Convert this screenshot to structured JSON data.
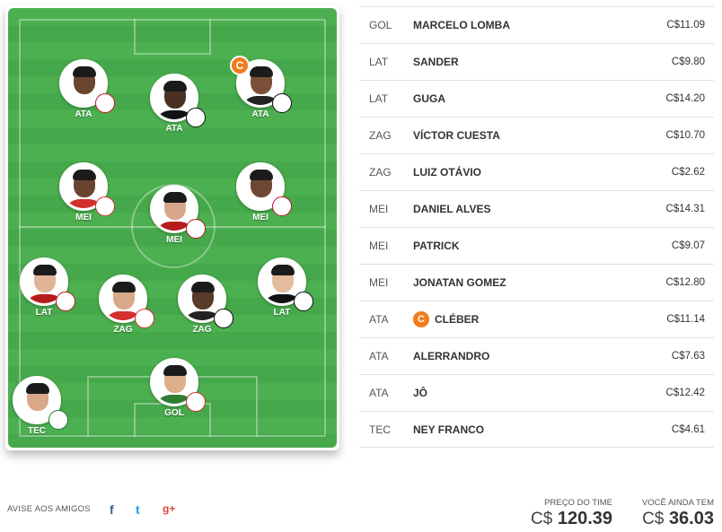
{
  "field": {
    "players": [
      {
        "id": "ata1",
        "pos": "ATA",
        "skin": "#6b4530",
        "shirt": "#ffffff",
        "badge": "RB",
        "badge_color": "#c8102e"
      },
      {
        "id": "ata2",
        "pos": "ATA",
        "skin": "#4a3124",
        "shirt": "#111111",
        "badge": "SC",
        "badge_color": "#111111"
      },
      {
        "id": "ata3",
        "pos": "ATA",
        "skin": "#7a5038",
        "shirt": "#222222",
        "badge": "CE",
        "badge_color": "#111111",
        "captain": "C"
      },
      {
        "id": "mei1",
        "pos": "MEI",
        "skin": "#6a4330",
        "shirt": "#d32f2f",
        "badge": "SCI",
        "badge_color": "#d32f2f"
      },
      {
        "id": "mei2",
        "pos": "MEI",
        "skin": "#d6a78a",
        "shirt": "#b71c1c",
        "badge": "SR",
        "badge_color": "#b71c1c"
      },
      {
        "id": "mei3",
        "pos": "MEI",
        "skin": "#6e4833",
        "shirt": "#ffffff",
        "badge": "SPFC",
        "badge_color": "#c8102e"
      },
      {
        "id": "lat1",
        "pos": "LAT",
        "skin": "#e0b496",
        "shirt": "#b71c1c",
        "badge": "SR",
        "badge_color": "#b71c1c"
      },
      {
        "id": "zag1",
        "pos": "ZAG",
        "skin": "#d9a888",
        "shirt": "#d32f2f",
        "badge": "SCI",
        "badge_color": "#d32f2f"
      },
      {
        "id": "zag2",
        "pos": "ZAG",
        "skin": "#5a3a28",
        "shirt": "#222222",
        "badge": "CE",
        "badge_color": "#111111"
      },
      {
        "id": "lat2",
        "pos": "LAT",
        "skin": "#e4bc9c",
        "shirt": "#111111",
        "badge": "CAM",
        "badge_color": "#111111"
      },
      {
        "id": "tec",
        "pos": "TEC",
        "skin": "#d9a888",
        "shirt": "#ffffff",
        "badge": "G",
        "badge_color": "#1e7a3c"
      },
      {
        "id": "gol",
        "pos": "GOL",
        "skin": "#dcae8c",
        "shirt": "#2e7d32",
        "badge": "SCI",
        "badge_color": "#d32f2f"
      }
    ]
  },
  "roster": [
    {
      "pos": "GOL",
      "name": "MARCELO LOMBA",
      "price": "C$11.09"
    },
    {
      "pos": "LAT",
      "name": "SANDER",
      "price": "C$9.80"
    },
    {
      "pos": "LAT",
      "name": "GUGA",
      "price": "C$14.20"
    },
    {
      "pos": "ZAG",
      "name": "VÍCTOR CUESTA",
      "price": "C$10.70"
    },
    {
      "pos": "ZAG",
      "name": "LUIZ OTÁVIO",
      "price": "C$2.62"
    },
    {
      "pos": "MEI",
      "name": "DANIEL ALVES",
      "price": "C$14.31"
    },
    {
      "pos": "MEI",
      "name": "PATRICK",
      "price": "C$9.07"
    },
    {
      "pos": "MEI",
      "name": "JONATAN GOMEZ",
      "price": "C$12.80"
    },
    {
      "pos": "ATA",
      "name": "CLÉBER",
      "price": "C$11.14",
      "captain": "C"
    },
    {
      "pos": "ATA",
      "name": "ALERRANDRO",
      "price": "C$7.63"
    },
    {
      "pos": "ATA",
      "name": "JÔ",
      "price": "C$12.42"
    },
    {
      "pos": "TEC",
      "name": "NEY FRANCO",
      "price": "C$4.61"
    }
  ],
  "footer": {
    "share_label": "AVISE AOS AMIGOS",
    "facebook_icon": "f",
    "twitter_icon": "t",
    "gplus_icon": "g+",
    "team_price_label": "PREÇO DO TIME",
    "team_price_currency": "C$",
    "team_price_value": "120.39",
    "remaining_label": "VOCÊ AINDA TEM",
    "remaining_currency": "C$",
    "remaining_value": "36.03"
  },
  "colors": {
    "captain": "#f07c1d",
    "facebook": "#3b5998",
    "twitter": "#1da1f2",
    "gplus": "#dd4b39"
  }
}
